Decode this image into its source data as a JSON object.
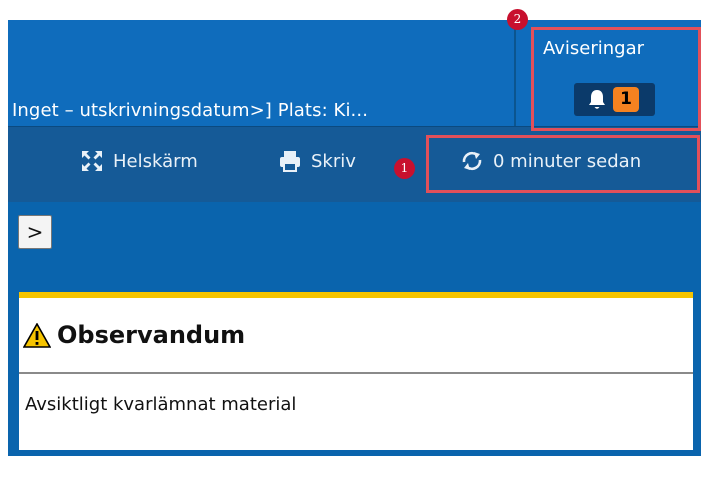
{
  "header": {
    "title": "Inget – utskrivningsdatum>] Plats: Ki...",
    "notifications": {
      "label": "Aviseringar",
      "count": "1"
    }
  },
  "toolbar": {
    "fullscreen_label": "Helskärm",
    "print_label": "Skriv",
    "refresh_label": "0 minuter sedan"
  },
  "content": {
    "expand_label": ">",
    "panel": {
      "title": "Observandum",
      "body": "Avsiktligt kvarlämnat material"
    }
  },
  "annotations": [
    {
      "number": "1"
    },
    {
      "number": "2"
    }
  ],
  "colors": {
    "header_bg": "#0f6cbc",
    "toolbar_bg": "#155a97",
    "accent_yellow": "#f6c400",
    "badge_orange": "#f58220",
    "annotation_red": "#e2505a"
  }
}
